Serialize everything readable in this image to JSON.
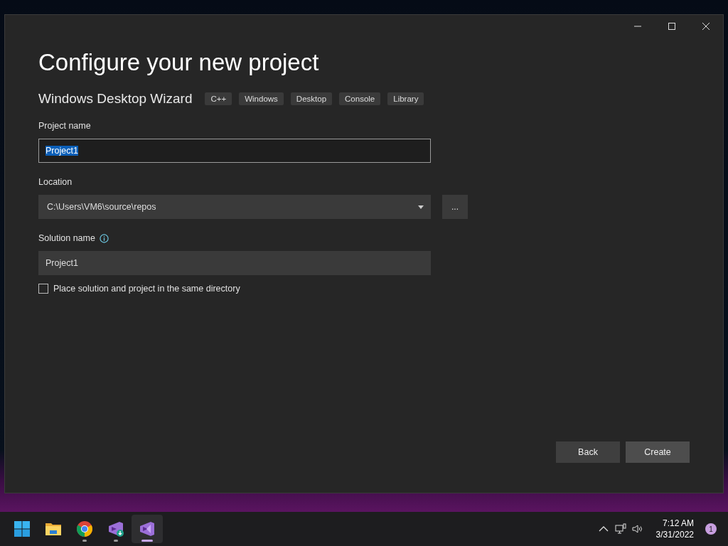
{
  "window": {
    "title": "Configure your new project",
    "template": "Windows Desktop Wizard",
    "tags": [
      "C++",
      "Windows",
      "Desktop",
      "Console",
      "Library"
    ],
    "fields": [
      {
        "kind": "text",
        "label": "Project name",
        "value": "Project1",
        "focused": true,
        "text_selected": true
      },
      {
        "kind": "dropdown",
        "label": "Location",
        "value": "C:\\Users\\VM6\\source\\repos",
        "browse": "..."
      },
      {
        "kind": "text",
        "label": "Solution name",
        "value": "Project1",
        "focused": false,
        "text_selected": false,
        "info": true
      }
    ],
    "checkbox": {
      "label": "Place solution and project in the same directory",
      "checked": false
    },
    "buttons": [
      {
        "label": "Back",
        "hovered": false
      },
      {
        "label": "Create",
        "hovered": true
      }
    ]
  },
  "taskbar": {
    "apps": [
      {
        "kind": "start",
        "running": false,
        "active": false
      },
      {
        "kind": "folder",
        "running": false,
        "active": false
      },
      {
        "kind": "browser",
        "running": true,
        "active": false
      },
      {
        "kind": "installer",
        "running": true,
        "active": false
      },
      {
        "kind": "studio",
        "running": true,
        "active": true
      }
    ],
    "time": "7:12 AM",
    "date": "3/31/2022",
    "notifications": "1"
  }
}
